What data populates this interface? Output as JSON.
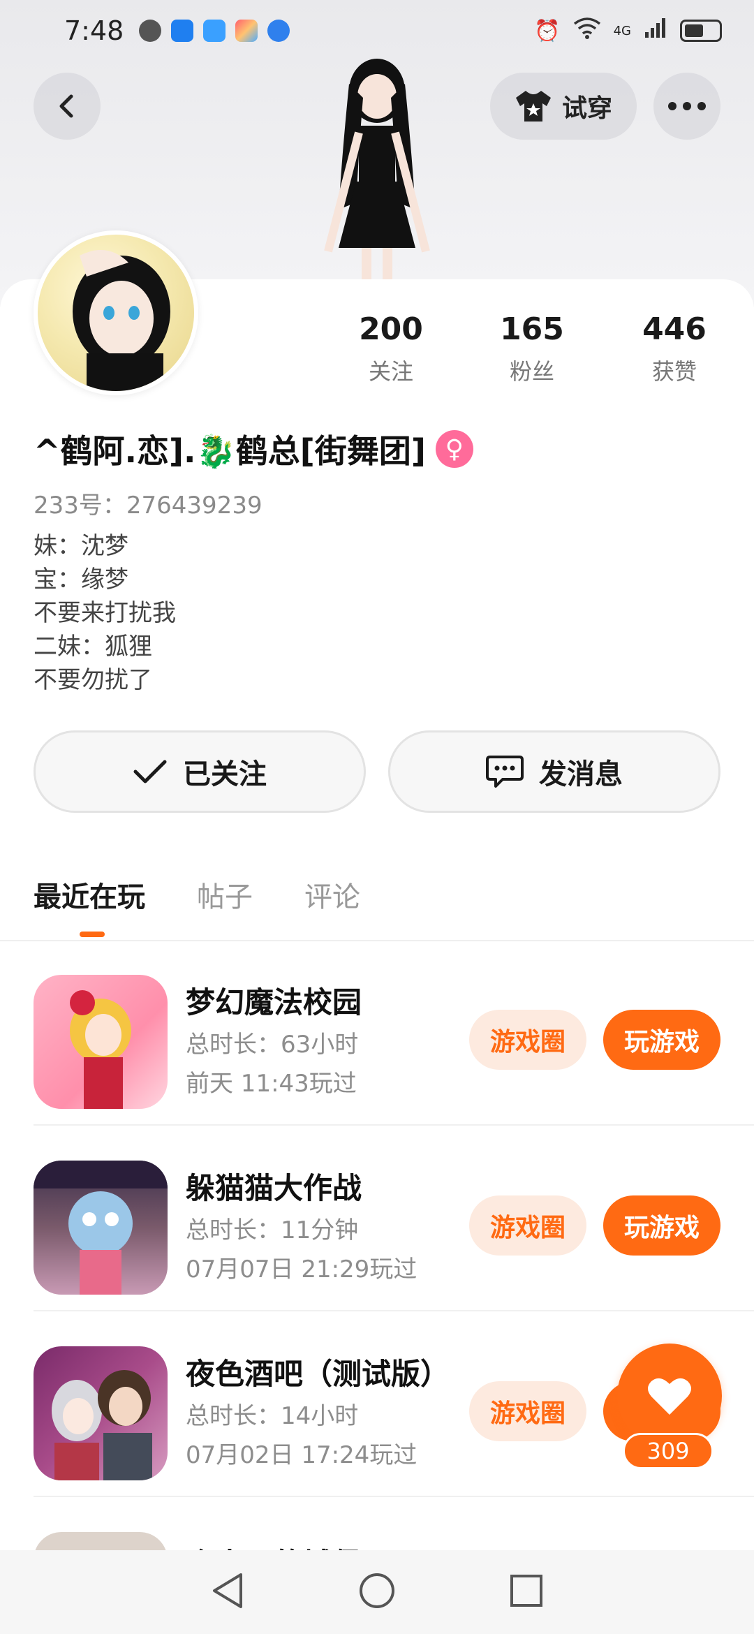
{
  "status_bar": {
    "time": "7:48",
    "network": "4G"
  },
  "header": {
    "back_label": "<",
    "try_on_label": "试穿"
  },
  "profile": {
    "stats": [
      {
        "value": "200",
        "label": "关注"
      },
      {
        "value": "165",
        "label": "粉丝"
      },
      {
        "value": "446",
        "label": "获赞"
      }
    ],
    "username": "^鹤阿.恋].🐉鹤总[街舞团]",
    "gender_symbol": "♀",
    "user_id": "233号：276439239",
    "bio_lines": [
      "妹：沈梦",
      "宝：缘梦",
      "不要来打扰我",
      "二妹：狐狸",
      "不要勿扰了"
    ]
  },
  "actions": {
    "follow_label": "已关注",
    "message_label": "发消息"
  },
  "tabs": [
    "最近在玩",
    "帖子",
    "评论"
  ],
  "games": [
    {
      "title": "梦幻魔法校园",
      "total_time": "总时长：63小时",
      "last_played": "前天 11:43玩过",
      "circle_label": "游戏圈",
      "play_label": "玩游戏"
    },
    {
      "title": "躲猫猫大作战",
      "total_time": "总时长：11分钟",
      "last_played": "07月07日 21:29玩过",
      "circle_label": "游戏圈",
      "play_label": "玩游戏"
    },
    {
      "title": "夜色酒吧（测试版）",
      "total_time": "总时长：14小时",
      "last_played": "07月02日 17:24玩过",
      "circle_label": "游戏圈",
      "play_label": "玩游戏"
    }
  ],
  "partial_game": {
    "title": "个人吧的城堡"
  },
  "like_fab": {
    "count": "309"
  },
  "colors": {
    "accent": "#ff6a13",
    "accent_light": "#fdeadf",
    "gender": "#ff6b9a"
  }
}
